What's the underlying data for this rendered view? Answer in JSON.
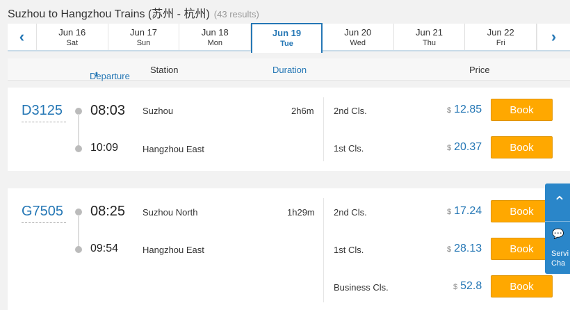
{
  "header": {
    "title": "Suzhou to Hangzhou Trains (苏州 - 杭州)",
    "results": "(43 results)"
  },
  "dates": [
    {
      "date": "Jun 16",
      "weekday": "Sat"
    },
    {
      "date": "Jun 17",
      "weekday": "Sun"
    },
    {
      "date": "Jun 18",
      "weekday": "Mon"
    },
    {
      "date": "Jun 19",
      "weekday": "Tue"
    },
    {
      "date": "Jun 20",
      "weekday": "Wed"
    },
    {
      "date": "Jun 21",
      "weekday": "Thu"
    },
    {
      "date": "Jun 22",
      "weekday": "Fri"
    }
  ],
  "nav": {
    "prev": "‹",
    "next": "›"
  },
  "columns": {
    "departure": "Departure",
    "sort": "⬍",
    "station": "Station",
    "duration": "Duration",
    "price": "Price"
  },
  "trains": [
    {
      "number": "D3125",
      "dep_time": "08:03",
      "dep_station": "Suzhou",
      "arr_time": "10:09",
      "arr_station": "Hangzhou East",
      "duration": "2h6m",
      "seats": [
        {
          "class": "2nd Cls.",
          "currency": "$",
          "price": "12.85",
          "book": "Book"
        },
        {
          "class": "1st Cls.",
          "currency": "$",
          "price": "20.37",
          "book": "Book"
        }
      ]
    },
    {
      "number": "G7505",
      "dep_time": "08:25",
      "dep_station": "Suzhou North",
      "arr_time": "09:54",
      "arr_station": "Hangzhou East",
      "duration": "1h29m",
      "seats": [
        {
          "class": "2nd Cls.",
          "currency": "$",
          "price": "17.24",
          "book": "Book"
        },
        {
          "class": "1st Cls.",
          "currency": "$",
          "price": "28.13",
          "book": "Book"
        },
        {
          "class": "Business Cls.",
          "currency": "$",
          "price": "52.8",
          "book": "Book"
        }
      ]
    }
  ],
  "side_widget": {
    "up": "⌃",
    "chat_icon": "💬",
    "label_line1": "Servi",
    "label_line2": "Cha"
  },
  "colors": {
    "accent": "#2577b5",
    "book": "#ffa800"
  }
}
